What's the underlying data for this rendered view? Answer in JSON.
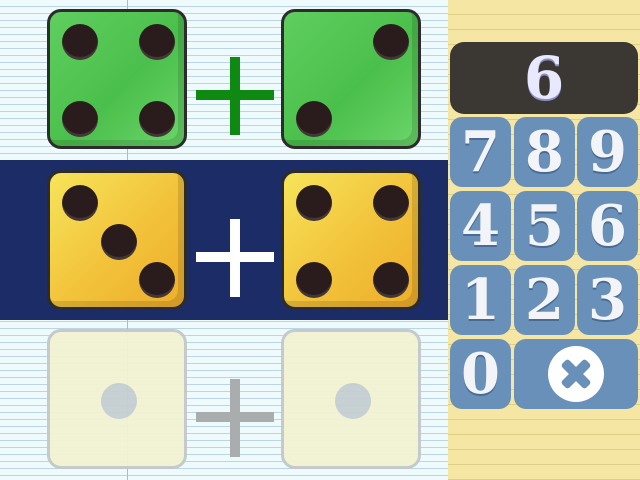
{
  "game": {
    "rows": [
      {
        "left_die": 4,
        "right_die": 2,
        "state": "answered",
        "color": "#4bbf4b",
        "operator": "+"
      },
      {
        "left_die": 3,
        "right_die": 4,
        "state": "active",
        "color": "#f2c23a",
        "operator": "+"
      },
      {
        "left_die": 1,
        "right_die": 1,
        "state": "pending",
        "color": "#f3f3d2",
        "operator": "+"
      }
    ],
    "active_band_color": "#1b2c66"
  },
  "keypad": {
    "display_value": "6",
    "keys": [
      "7",
      "8",
      "9",
      "4",
      "5",
      "6",
      "1",
      "2",
      "3",
      "0"
    ],
    "clear_icon": "clear-x-icon",
    "key_color": "#6890b8"
  }
}
